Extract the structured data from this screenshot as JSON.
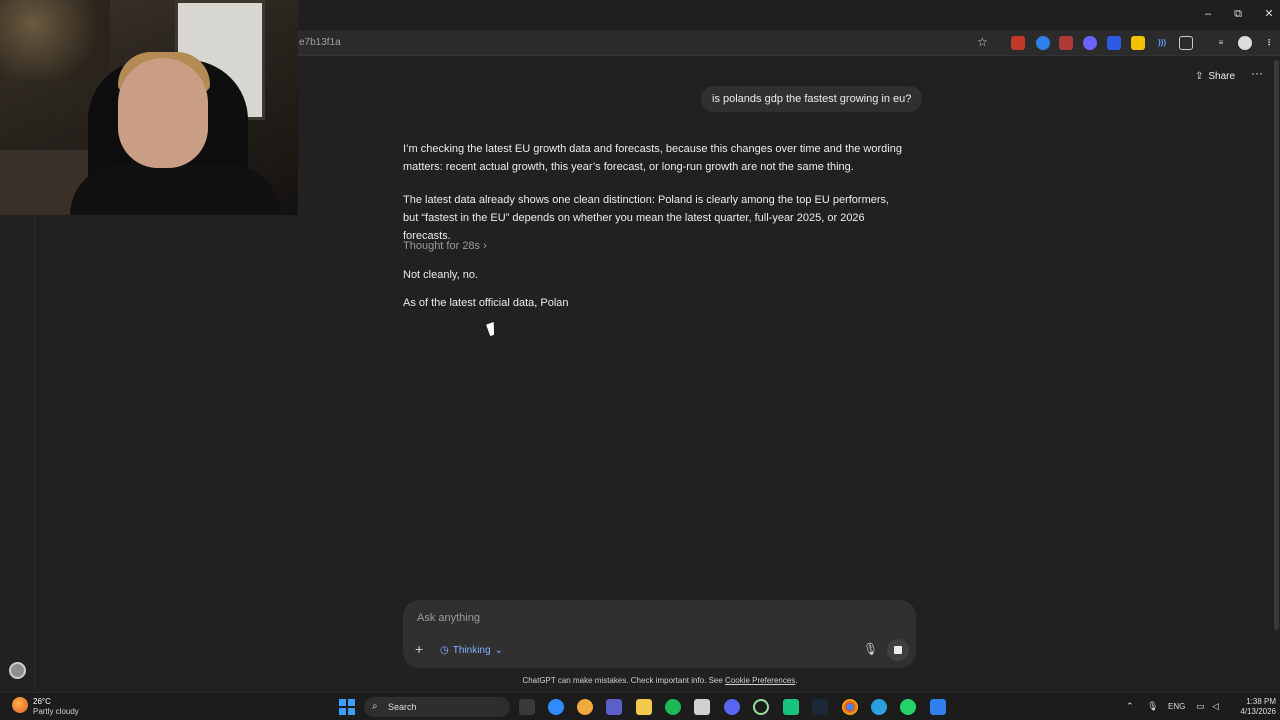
{
  "browser": {
    "url_fragment": "e7b13f1a",
    "window_controls": {
      "minimize": "–",
      "restore": "⧉",
      "close": "✕"
    }
  },
  "header": {
    "share_label": "Share",
    "more_label": "···"
  },
  "conversation": {
    "user_message": "is polands gdp the fastest growing in eu?",
    "assistant_para_1": "I’m checking the latest EU growth data and forecasts, because this changes over time and the wording matters: recent actual growth, this year’s forecast, or long-run growth are not the same thing.",
    "assistant_para_2": "The latest data already shows one clean distinction: Poland is clearly among the top EU performers, but “fastest in the EU” depends on whether you mean the latest quarter, full-year 2025, or 2026 forecasts.",
    "thought_label": "Thought for 28s ›",
    "answer_line_1": "Not cleanly, no.",
    "answer_line_2": "As of the latest official data, Polan"
  },
  "composer": {
    "placeholder": "Ask anything",
    "plus_label": "+",
    "mode_label": "Thinking",
    "mode_chevron": "⌄"
  },
  "disclaimer": {
    "text": "ChatGPT can make mistakes. Check important info. See ",
    "link": "Cookie Preferences",
    "end": "."
  },
  "taskbar": {
    "weather_temp": "26°C",
    "weather_desc": "Partly cloudy",
    "search_label": "Search",
    "language": "ENG",
    "time": "1:38 PM",
    "date": "4/13/2026"
  },
  "colors": {
    "background": "#212121",
    "bubble": "#303030",
    "accent": "#7fb3ff",
    "muted": "#9b9b9b"
  }
}
